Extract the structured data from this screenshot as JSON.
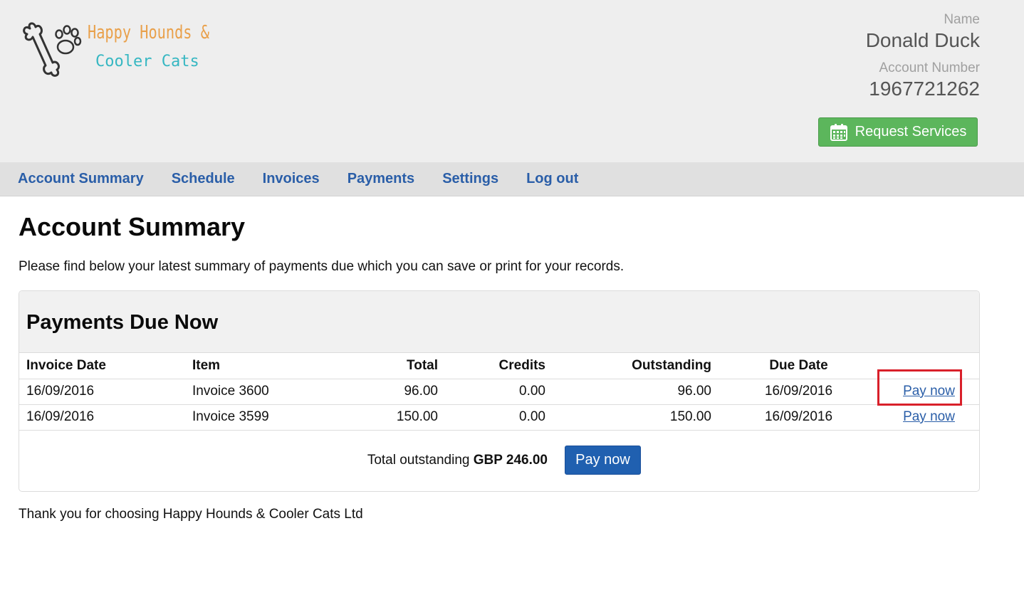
{
  "colors": {
    "link": "#2a5ea8",
    "brand_orange": "#e9a04a",
    "brand_teal": "#36b7c2",
    "green_button": "#5cb65c",
    "blue_button": "#2060b0",
    "highlight_red": "#d9202a"
  },
  "brand": {
    "line1": "Happy Hounds &",
    "line2": "Cooler Cats",
    "icon": "bone-paw-icon"
  },
  "account": {
    "name_label": "Name",
    "name_value": "Donald Duck",
    "number_label": "Account Number",
    "number_value": "1967721262"
  },
  "request_button": {
    "label": "Request Services",
    "icon": "calendar-icon"
  },
  "nav": {
    "items": [
      "Account Summary",
      "Schedule",
      "Invoices",
      "Payments",
      "Settings",
      "Log out"
    ]
  },
  "main": {
    "title": "Account Summary",
    "intro": "Please find below your latest summary of payments due which you can save or print for your records.",
    "footer": "Thank you for choosing Happy Hounds & Cooler Cats Ltd"
  },
  "payments": {
    "heading": "Payments Due Now",
    "columns": [
      "Invoice Date",
      "Item",
      "Total",
      "Credits",
      "Outstanding",
      "Due Date"
    ],
    "rows": [
      {
        "invoice_date": "16/09/2016",
        "item": "Invoice 3600",
        "total": "96.00",
        "credits": "0.00",
        "outstanding": "96.00",
        "due_date": "16/09/2016",
        "action": "Pay now"
      },
      {
        "invoice_date": "16/09/2016",
        "item": "Invoice 3599",
        "total": "150.00",
        "credits": "0.00",
        "outstanding": "150.00",
        "due_date": "16/09/2016",
        "action": "Pay now"
      }
    ],
    "total_label": "Total outstanding",
    "total_value": "GBP 246.00",
    "pay_button": "Pay now"
  }
}
